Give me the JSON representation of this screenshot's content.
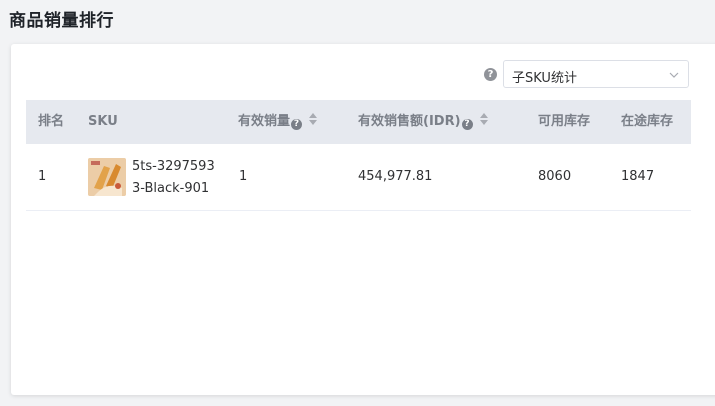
{
  "page": {
    "title": "商品销量排行"
  },
  "filter": {
    "help_icon": "?",
    "selected": "子SKU统计"
  },
  "table": {
    "columns": {
      "rank": "排名",
      "sku": "SKU",
      "sales_qty": "有效销量",
      "sales_amount": "有效销售额(IDR)",
      "available_stock": "可用库存",
      "in_transit_stock": "在途库存"
    },
    "help_glyph": "?",
    "rows": [
      {
        "rank": "1",
        "sku": "5ts-32975933-Black-901",
        "sales_qty": "1",
        "sales_amount": "454,977.81",
        "available_stock": "8060",
        "in_transit_stock": "1847"
      }
    ]
  },
  "icons": {
    "help": "question-circle-icon",
    "sort": "sort-caret-icon",
    "dropdown": "chevron-down-icon"
  },
  "colors": {
    "header_bg": "#e6e9ef",
    "page_bg": "#f2f3f5"
  }
}
